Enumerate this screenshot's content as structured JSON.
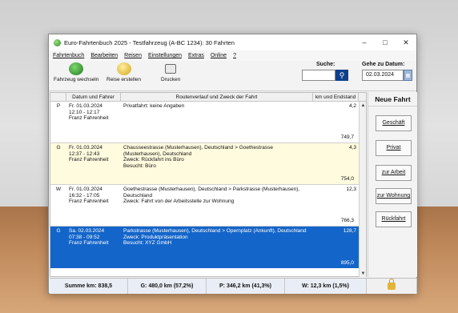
{
  "window": {
    "title": "Euro-Fahrtenbuch 2025 - Testfahrzeug (A-BC 1234): 30 Fahrten"
  },
  "menu": [
    "Fahrtenbuch",
    "Bearbeiten",
    "Reisen",
    "Einstellungen",
    "Extras",
    "Online",
    "?"
  ],
  "toolbar": {
    "vehicle_change": "Fahrzeug wechseln",
    "create_trip": "Reise erstellen",
    "print": "Drucken"
  },
  "search": {
    "label": "Suche:",
    "value": ""
  },
  "goto_date": {
    "label": "Gehe zu Datum:",
    "value": "02.03.2024"
  },
  "table": {
    "headers": [
      "Datum und Fahrer",
      "Routenverlauf und Zweck der Fahrt",
      "km und Endstand"
    ],
    "rows": [
      {
        "type": "P",
        "date": "Fr. 01.03.2024",
        "time": "12:10 - 12:17",
        "driver": "Franz Fahrenheit",
        "route": "Privatfahrt: keine Angaben",
        "purpose": "",
        "visited": "",
        "km": "4,2",
        "end": "749,7"
      },
      {
        "type": "G",
        "date": "Fr. 01.03.2024",
        "time": "12:37 - 12:43",
        "driver": "Franz Fahrenheit",
        "route": "Chausseestrasse (Musterhausen), Deutschland > Goethestrasse (Musterhausen), Deutschland",
        "purpose": "Zweck: Rückfahrt ins Büro",
        "visited": "Besucht: Büro",
        "km": "4,3",
        "end": "754,0"
      },
      {
        "type": "W",
        "date": "Fr. 01.03.2024",
        "time": "16:32 - 17:05",
        "driver": "Franz Fahrenheit",
        "route": "Goethestrasse (Musterhausen), Deutschland > Parkstrasse (Musterhausen), Deutschland",
        "purpose": "Zweck: Fahrt von der Arbeitsstelle zur Wohnung",
        "visited": "",
        "km": "12,3",
        "end": "766,3"
      },
      {
        "type": "G",
        "date": "Sa. 02.03.2024",
        "time": "07:38 - 09:52",
        "driver": "Franz Fahrenheit",
        "route": "Parkstrasse (Musterhausen), Deutschland > Opernplatz (Ankunft), Deutschland",
        "purpose": "Zweck: Produktpräsentation",
        "visited": "Besucht: XYZ GmbH",
        "km": "128,7",
        "end": "895,0"
      }
    ]
  },
  "sidepanel": {
    "title": "Neue Fahrt",
    "buttons": [
      "Geschäft",
      "Privat",
      "zur Arbeit",
      "zur Wohnung",
      "Rückfahrt"
    ]
  },
  "status": {
    "total": "Summe km: 838,5",
    "business": "G: 480,0 km (57,2%)",
    "private": "P: 346,2 km (41,3%)",
    "commute": "W: 12,3 km (1,5%)"
  }
}
